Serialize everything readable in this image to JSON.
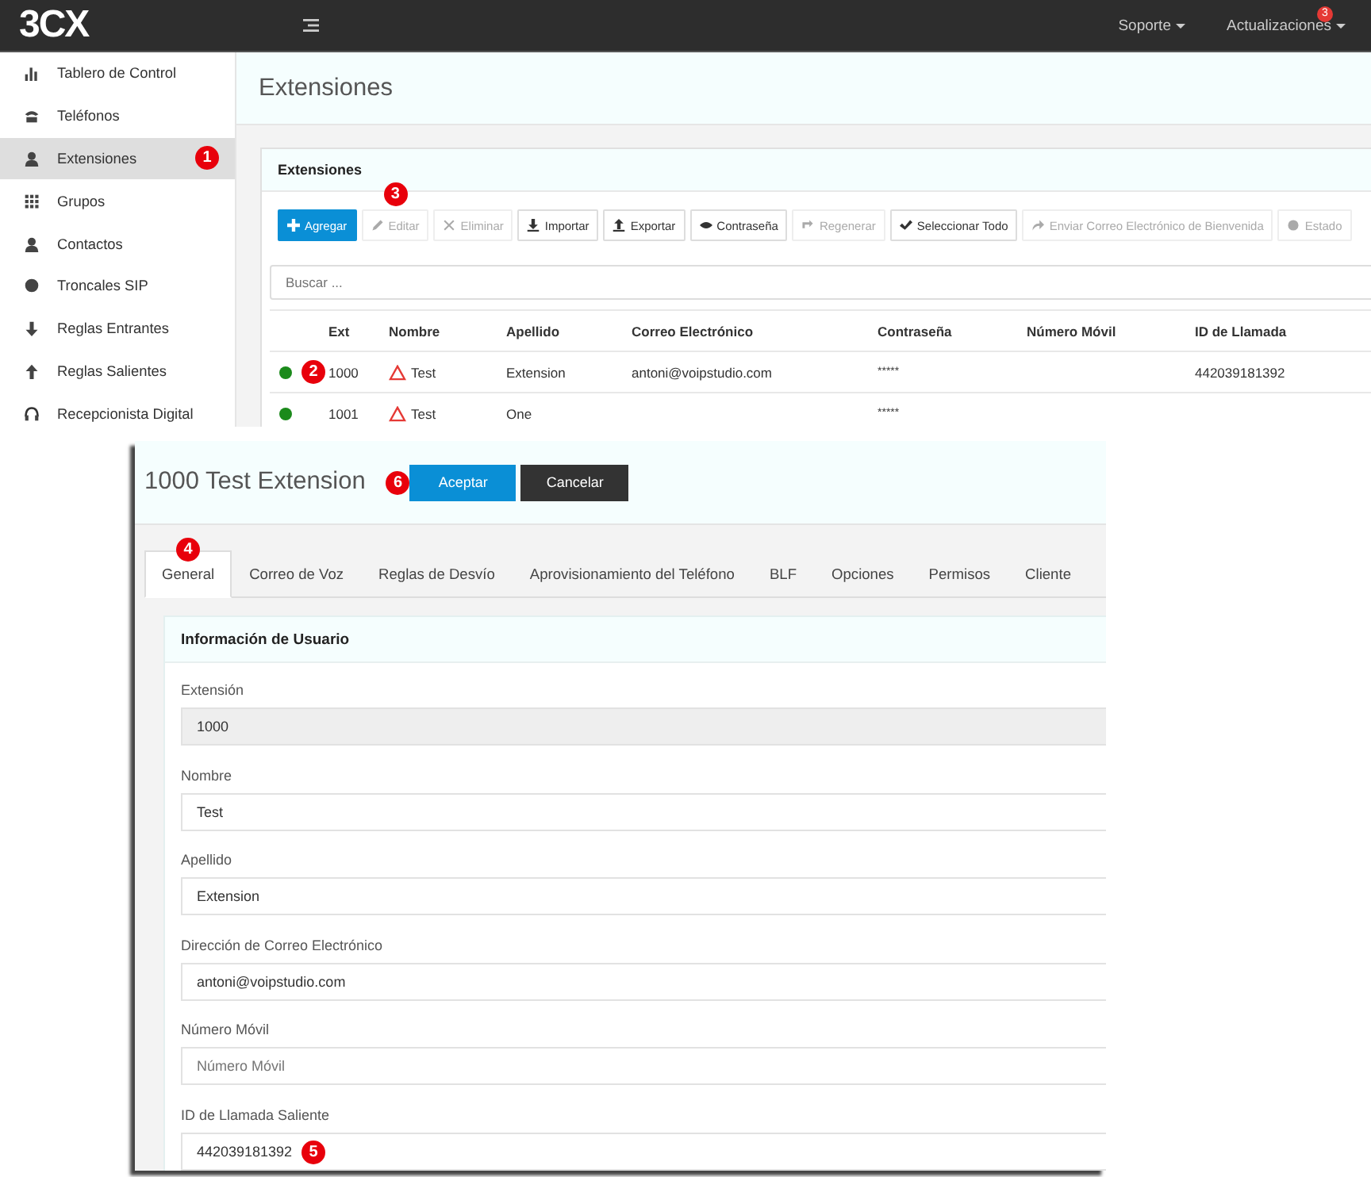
{
  "topbar": {
    "logo": "3CX",
    "links": [
      {
        "label": "Soporte"
      },
      {
        "label": "Actualizaciones",
        "badge": "3"
      }
    ]
  },
  "sidebar": {
    "items": [
      {
        "label": "Tablero de Control",
        "selected": false
      },
      {
        "label": "Teléfonos",
        "selected": false
      },
      {
        "label": "Extensiones",
        "selected": true,
        "marker": "1"
      },
      {
        "label": "Grupos",
        "selected": false
      },
      {
        "label": "Contactos",
        "selected": false
      },
      {
        "label": "Troncales SIP",
        "selected": false
      },
      {
        "label": "Reglas Entrantes",
        "selected": false
      },
      {
        "label": "Reglas Salientes",
        "selected": false
      },
      {
        "label": "Recepcionista Digital",
        "selected": false
      }
    ]
  },
  "page": {
    "title": "Extensiones"
  },
  "card": {
    "title": "Extensiones",
    "toolbar": [
      {
        "label": "Agregar",
        "kind": "primary",
        "disabled": false
      },
      {
        "label": "Editar",
        "kind": "default",
        "disabled": true,
        "marker": "3"
      },
      {
        "label": "Eliminar",
        "kind": "default",
        "disabled": true
      },
      {
        "label": "Importar",
        "kind": "default",
        "disabled": false
      },
      {
        "label": "Exportar",
        "kind": "default",
        "disabled": false
      },
      {
        "label": "Contraseña",
        "kind": "default",
        "disabled": false
      },
      {
        "label": "Regenerar",
        "kind": "default",
        "disabled": true
      },
      {
        "label": "Seleccionar Todo",
        "kind": "default",
        "disabled": false
      },
      {
        "label": "Enviar Correo Electrónico de Bienvenida",
        "kind": "default",
        "disabled": true
      },
      {
        "label": "Estado",
        "kind": "default",
        "disabled": true
      }
    ],
    "search": {
      "placeholder": "Buscar ..."
    },
    "table": {
      "columns": [
        "Ext",
        "Nombre",
        "Apellido",
        "Correo Electrónico",
        "Contraseña",
        "Número Móvil",
        "ID de Llamada"
      ],
      "rows": [
        {
          "color": "#1b8a1b",
          "marker": "2",
          "cells": [
            "1000",
            "Test",
            "Extension",
            "antoni@voipstudio.com",
            "*****",
            "",
            "442039181392"
          ]
        },
        {
          "color": "#1b8a1b",
          "cells": [
            "1001",
            "Test",
            "One",
            "",
            "*****",
            "",
            ""
          ]
        }
      ]
    }
  },
  "dialog": {
    "title": "1000 Test Extension",
    "marker": "6",
    "buttons": [
      {
        "label": "Aceptar",
        "kind": "primary"
      },
      {
        "label": "Cancelar",
        "kind": "dark"
      }
    ],
    "tabs": [
      {
        "label": "General",
        "selected": true,
        "marker": "4"
      },
      {
        "label": "Correo de Voz",
        "selected": false
      },
      {
        "label": "Reglas de Desvío",
        "selected": false
      },
      {
        "label": "Aprovisionamiento del Teléfono",
        "selected": false
      },
      {
        "label": "BLF",
        "selected": false
      },
      {
        "label": "Opciones",
        "selected": false
      },
      {
        "label": "Permisos",
        "selected": false
      },
      {
        "label": "Cliente",
        "selected": false
      }
    ],
    "section": "Información de Usuario",
    "fields": [
      {
        "label": "Extensión",
        "value": "1000",
        "disabled": true
      },
      {
        "label": "Nombre",
        "value": "Test",
        "disabled": false
      },
      {
        "label": "Apellido",
        "value": "Extension",
        "disabled": false
      },
      {
        "label": "Dirección de Correo Electrónico",
        "value": "antoni@voipstudio.com",
        "disabled": false
      },
      {
        "label": "Número Móvil",
        "placeholder": "Número Móvil",
        "disabled": false
      },
      {
        "label": "ID de Llamada Saliente",
        "value": "442039181392",
        "disabled": false,
        "marker": "5"
      }
    ]
  }
}
